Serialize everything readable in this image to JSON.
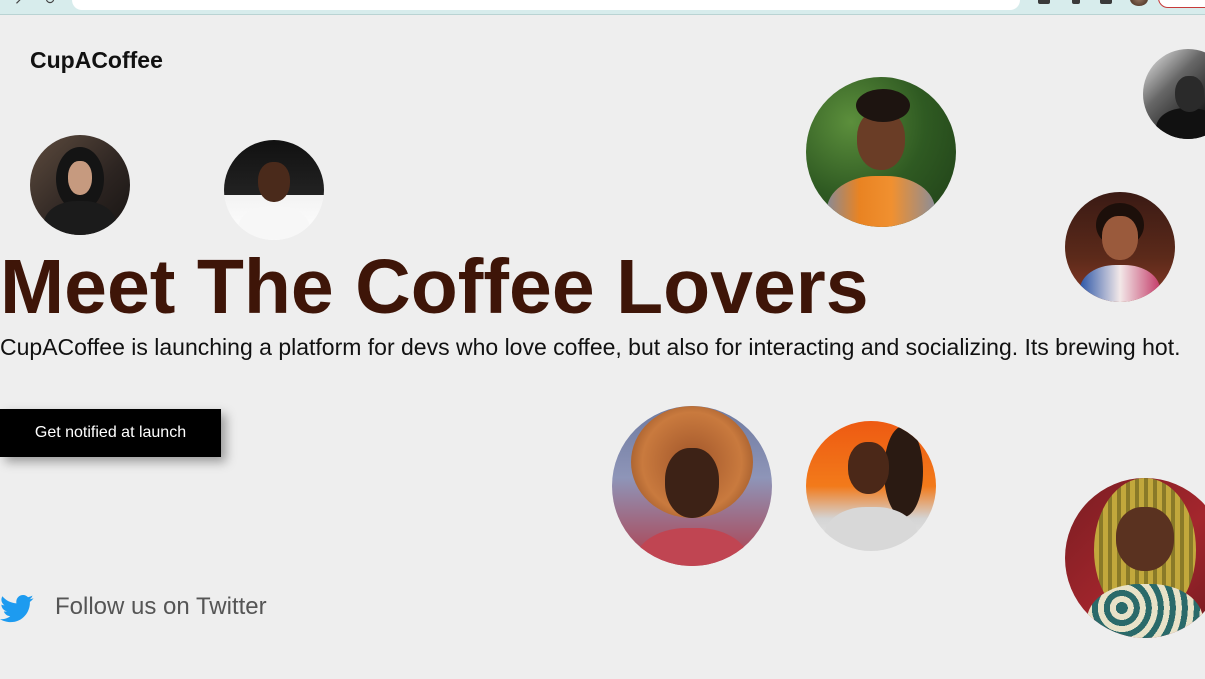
{
  "header": {
    "logo_text": "CupACoffee"
  },
  "hero": {
    "title": "Meet The Coffee Lovers",
    "subtitle": "CupACoffee is launching a platform for devs who love coffee, but also for interacting and socializing. Its brewing hot.",
    "cta_label": "Get notified at launch"
  },
  "social": {
    "twitter_text": "Follow us on Twitter",
    "icon": "twitter-bird-icon"
  },
  "colors": {
    "background": "#eeeeee",
    "title": "#3e1508",
    "cta_background": "#000000",
    "cta_text": "#ffffff",
    "twitter_blue": "#1d9bf0",
    "twitter_text": "#555555"
  }
}
